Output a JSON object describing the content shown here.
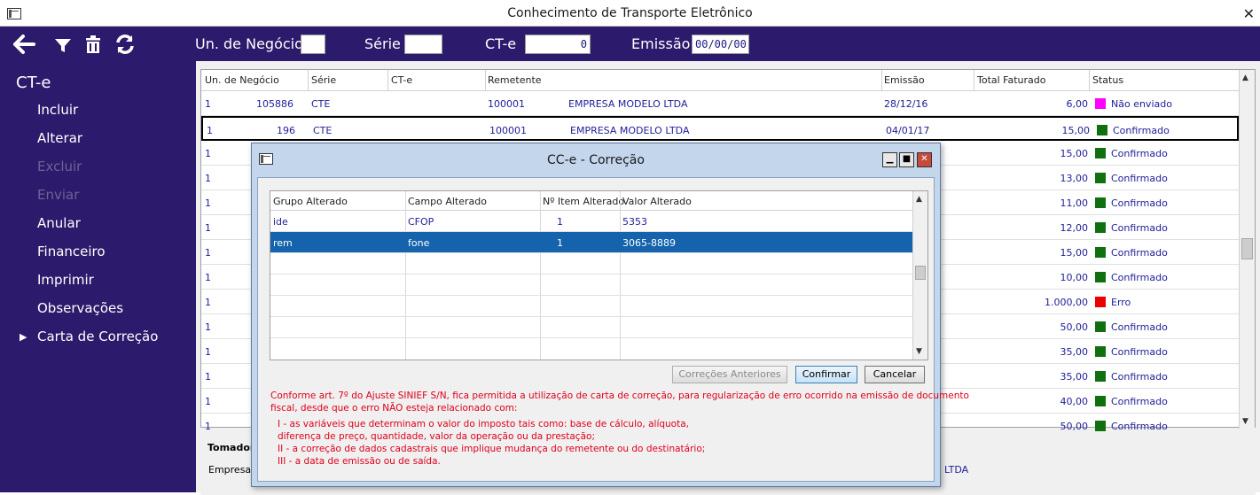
{
  "window": {
    "title": "Conhecimento de Transporte Eletrônico",
    "close_glyph": "✕"
  },
  "toolbar": {
    "icons": [
      "back-arrow-icon",
      "filter-icon",
      "trash-icon",
      "refresh-icon"
    ],
    "un_negocio_label": "Un. de Negócio",
    "un_negocio_value": "",
    "serie_label": "Série",
    "serie_value": "",
    "cte_label": "CT-e",
    "cte_value": "0",
    "emissao_label": "Emissão",
    "emissao_value": "00/00/00"
  },
  "sidebar": {
    "title": "CT-e",
    "items": [
      {
        "label": "Incluir",
        "enabled": true
      },
      {
        "label": "Alterar",
        "enabled": true
      },
      {
        "label": "Excluir",
        "enabled": false
      },
      {
        "label": "Enviar",
        "enabled": false
      },
      {
        "label": "Anular",
        "enabled": true
      },
      {
        "label": "Financeiro",
        "enabled": true
      },
      {
        "label": "Imprimir",
        "enabled": true
      },
      {
        "label": "Observações",
        "enabled": true
      },
      {
        "label": "Carta de Correção",
        "enabled": true,
        "expand_arrow": "▶"
      }
    ]
  },
  "grid": {
    "headers": [
      "Un. de Negócio",
      "Série",
      "CT-e",
      "Remetente",
      "Emissão",
      "Total Faturado",
      "Status"
    ],
    "rows": [
      {
        "un": "1",
        "serie": "CTE",
        "cte": "105886",
        "rem_code": "100001",
        "rem_name": "EMPRESA MODELO LTDA",
        "emissao": "28/12/16",
        "total": "6,00",
        "status": "Não enviado",
        "status_color": "#ff00ff"
      },
      {
        "un": "1",
        "serie": "CTE",
        "cte": "196",
        "rem_code": "100001",
        "rem_name": "EMPRESA MODELO LTDA",
        "emissao": "04/01/17",
        "total": "15,00",
        "status": "Confirmado",
        "status_color": "#107010"
      },
      {
        "un": "1",
        "serie": "",
        "cte": "",
        "rem_code": "",
        "rem_name": "",
        "emissao": "",
        "total": "15,00",
        "status": "Confirmado",
        "status_color": "#107010"
      },
      {
        "un": "1",
        "serie": "",
        "cte": "",
        "rem_code": "",
        "rem_name": "",
        "emissao": "",
        "total": "13,00",
        "status": "Confirmado",
        "status_color": "#107010"
      },
      {
        "un": "1",
        "serie": "",
        "cte": "",
        "rem_code": "",
        "rem_name": "",
        "emissao": "",
        "total": "11,00",
        "status": "Confirmado",
        "status_color": "#107010"
      },
      {
        "un": "1",
        "serie": "",
        "cte": "",
        "rem_code": "",
        "rem_name": "",
        "emissao": "",
        "total": "12,00",
        "status": "Confirmado",
        "status_color": "#107010"
      },
      {
        "un": "1",
        "serie": "",
        "cte": "",
        "rem_code": "",
        "rem_name": "",
        "emissao": "",
        "total": "15,00",
        "status": "Confirmado",
        "status_color": "#107010"
      },
      {
        "un": "1",
        "serie": "",
        "cte": "",
        "rem_code": "",
        "rem_name": "",
        "emissao": "",
        "total": "10,00",
        "status": "Confirmado",
        "status_color": "#107010"
      },
      {
        "un": "1",
        "serie": "",
        "cte": "",
        "rem_code": "",
        "rem_name": "",
        "emissao": "",
        "total": "1.000,00",
        "status": "Erro",
        "status_color": "#ee0000"
      },
      {
        "un": "1",
        "serie": "",
        "cte": "",
        "rem_code": "",
        "rem_name": "",
        "emissao": "",
        "total": "50,00",
        "status": "Confirmado",
        "status_color": "#107010"
      },
      {
        "un": "1",
        "serie": "",
        "cte": "",
        "rem_code": "",
        "rem_name": "",
        "emissao": "",
        "total": "35,00",
        "status": "Confirmado",
        "status_color": "#107010"
      },
      {
        "un": "1",
        "serie": "",
        "cte": "",
        "rem_code": "",
        "rem_name": "",
        "emissao": "",
        "total": "35,00",
        "status": "Confirmado",
        "status_color": "#107010"
      },
      {
        "un": "1",
        "serie": "",
        "cte": "",
        "rem_code": "",
        "rem_name": "",
        "emissao": "",
        "total": "40,00",
        "status": "Confirmado",
        "status_color": "#107010"
      },
      {
        "un": "1",
        "serie": "",
        "cte": "",
        "rem_code": "",
        "rem_name": "",
        "emissao": "",
        "total": "50,00",
        "status": "Confirmado",
        "status_color": "#107010"
      }
    ]
  },
  "bottom": {
    "tomador_label": "Tomador",
    "empresa_label": "Empresa",
    "empresa_suffix": "LTDA"
  },
  "dialog": {
    "title": "CC-e - Correção",
    "headers": [
      "Grupo Alterado",
      "Campo Alterado",
      "Nº Item Alterado",
      "Valor Alterado"
    ],
    "rows": [
      {
        "grupo": "ide",
        "campo": "CFOP",
        "item": "1",
        "valor": "5353"
      },
      {
        "grupo": "rem",
        "campo": "fone",
        "item": "1",
        "valor": "3065-8889"
      }
    ],
    "btn_anteriores": "Correções Anteriores",
    "btn_confirmar": "Confirmar",
    "btn_cancelar": "Cancelar",
    "note_lines": [
      "Conforme art. 7º do Ajuste SINIEF S/N, fica permitida a utilização de carta de correção, para regularização de erro ocorrido na emissão de documento",
      "fiscal, desde que o erro NÃO esteja relacionado com:",
      "I - as variáveis que determinam o valor do imposto tais como: base de cálculo, alíquota,",
      "diferença de  preço, quantidade, valor da operação ou da prestação;",
      "II - a correção de dados cadastrais que implique mudança do remetente ou do destinatário;",
      "III - a data de emissão ou de saída."
    ]
  }
}
